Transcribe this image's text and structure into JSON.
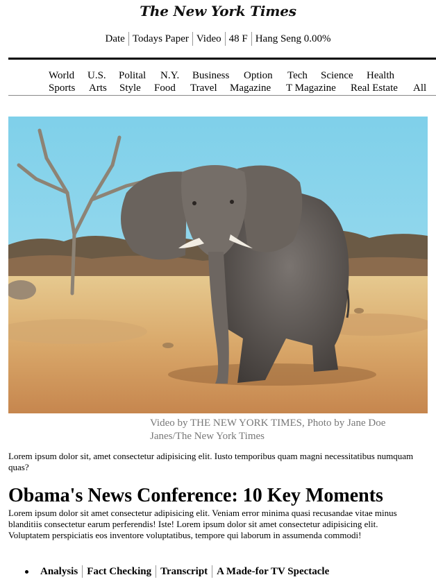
{
  "masthead": {
    "logo_text": "The New York Times"
  },
  "meta": [
    "Date",
    "Todays Paper",
    "Video",
    "48 F",
    "Hang Seng 0.00%"
  ],
  "nav": {
    "row1": [
      "World",
      "U.S.",
      "Polital",
      "N.Y.",
      "Business",
      "Option",
      "Tech",
      "Science",
      "Health"
    ],
    "row2": [
      "Sports",
      "Arts",
      "Style",
      "Food",
      "Travel",
      "Magazine",
      "T Magazine",
      "Real Estate",
      "All"
    ]
  },
  "hero": {
    "image_icon": "elephant-photo"
  },
  "caption": "Video by THE NEW YORK TIMES, Photo by Jane Doe Janes/The New York Times",
  "intro": "Lorem ipsum dolor sit, amet consectetur adipisicing elit. Iusto temporibus quam magni necessitatibus numquam quas?",
  "article": {
    "headline": "Obama's News Conference: 10 Key Moments",
    "body": "Lorem ipsum dolor sit amet consectetur adipisicing elit. Veniam error minima quasi recusandae vitae minus blanditiis consectetur earum perferendis! Iste! Lorem ipsum dolor sit amet consectetur adipisicing elit. Voluptatem perspiciatis eos inventore voluptatibus, tempore qui laborum in assumenda commodi!",
    "related": [
      "Analysis",
      "Fact Checking",
      "Transcript",
      "A Made-for TV Spectacle"
    ]
  }
}
